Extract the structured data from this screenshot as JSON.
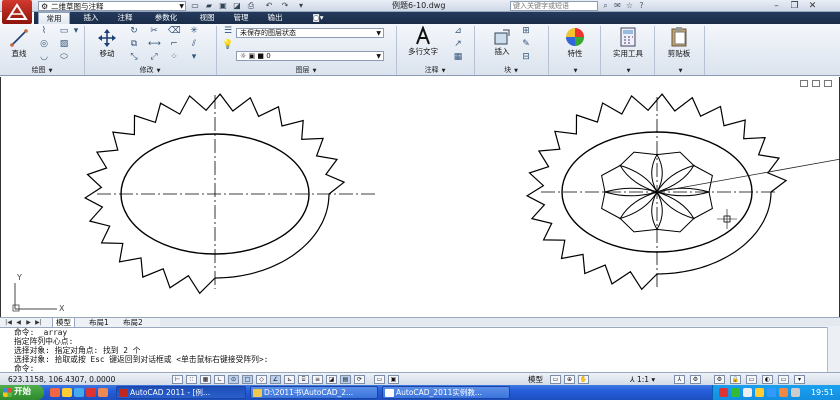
{
  "titlebar": {
    "workspace": "二维草图与注释",
    "document_title": "例题6-10.dwg",
    "search_placeholder": "键入关键字或短语"
  },
  "ribbon_tabs": [
    "常用",
    "插入",
    "注释",
    "参数化",
    "视图",
    "管理",
    "输出"
  ],
  "ribbon": {
    "draw": {
      "label": "绘图",
      "line_label": "直线"
    },
    "modify": {
      "label": "修改",
      "move_label": "移动"
    },
    "layers": {
      "label": "图层",
      "state_value": "未保存的图层状态",
      "layer_value": "0"
    },
    "annotation": {
      "label": "注释",
      "mtext_label": "多行文字"
    },
    "block": {
      "label": "块",
      "insert_label": "插入"
    },
    "properties_label": "特性",
    "utilities_label": "实用工具",
    "clipboard_label": "剪贴板"
  },
  "layout_tabs": [
    "模型",
    "布局1",
    "布局2"
  ],
  "ucs": {
    "x": "X",
    "y": "Y"
  },
  "command_lines": [
    "命令:  _array",
    "指定阵列中心点:",
    "选择对象: 指定对角点: 找到 2 个",
    "选择对象:  拾取或按 Esc 键返回到对话框或 <单击鼠标右键接受阵列>:",
    "命令:"
  ],
  "statusbar": {
    "coords": "623.1158, 106.4307, 0.0000",
    "model_label": "模型",
    "scale_label": "1:1"
  },
  "taskbar": {
    "start_label": "开始",
    "tasks": [
      "AutoCAD 2011 - [例...",
      "D:\\2011书\\AutoCAD_2...",
      "AutoCAD_2011实例教..."
    ],
    "clock": "19:51"
  },
  "colors": {
    "tab_bar": "#1a2c48",
    "autocad_red": "#c0281d",
    "taskbar_blue": "#245edb",
    "start_green": "#3c9b39"
  }
}
